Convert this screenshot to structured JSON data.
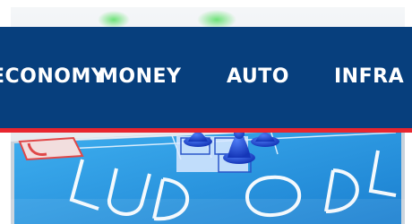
{
  "hero": {
    "alt": "Ludo board game with blue pawns",
    "board_text": "LUDO"
  },
  "nav": {
    "items": [
      {
        "label": "ECONOMY"
      },
      {
        "label": "MONEY"
      },
      {
        "label": "AUTO"
      },
      {
        "label": "INFRA"
      }
    ]
  },
  "colors": {
    "nav_background": "#073f7d",
    "nav_underline": "#e8262f",
    "nav_text": "#ffffff"
  }
}
